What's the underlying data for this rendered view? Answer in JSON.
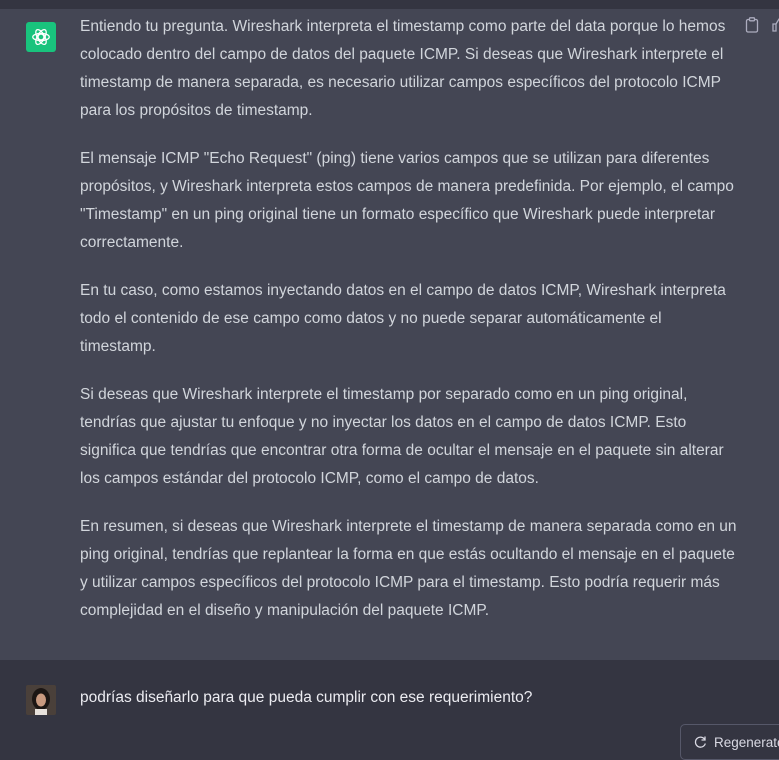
{
  "assistant_message": {
    "avatar_icon": "openai-logo-icon",
    "avatar_color": "#19c37d",
    "paragraphs": [
      "Entiendo tu pregunta. Wireshark interpreta el timestamp como parte del data porque lo hemos colocado dentro del campo de datos del paquete ICMP. Si deseas que Wireshark interprete el timestamp de manera separada, es necesario utilizar campos específicos del protocolo ICMP para los propósitos de timestamp.",
      "El mensaje ICMP \"Echo Request\" (ping) tiene varios campos que se utilizan para diferentes propósitos, y Wireshark interpreta estos campos de manera predefinida. Por ejemplo, el campo \"Timestamp\" en un ping original tiene un formato específico que Wireshark puede interpretar correctamente.",
      "En tu caso, como estamos inyectando datos en el campo de datos ICMP, Wireshark interpreta todo el contenido de ese campo como datos y no puede separar automáticamente el timestamp.",
      "Si deseas que Wireshark interprete el timestamp por separado como en un ping original, tendrías que ajustar tu enfoque y no inyectar los datos en el campo de datos ICMP. Esto significa que tendrías que encontrar otra forma de ocultar el mensaje en el paquete sin alterar los campos estándar del protocolo ICMP, como el campo de datos.",
      "En resumen, si deseas que Wireshark interprete el timestamp de manera separada como en un ping original, tendrías que replantear la forma en que estás ocultando el mensaje en el paquete y utilizar campos específicos del protocolo ICMP para el timestamp. Esto podría requerir más complejidad en el diseño y manipulación del paquete ICMP."
    ]
  },
  "user_message": {
    "avatar_icon": "user-photo-avatar",
    "text": "podrías diseñarlo para que pueda cumplir con ese requerimiento?"
  },
  "actions": {
    "copy_icon": "clipboard-icon",
    "feedback_icon": "thumbs-up-icon",
    "regenerate_label": "Regenerate",
    "regenerate_icon": "refresh-icon"
  },
  "colors": {
    "page_bg": "#343541",
    "assistant_bg": "#444654",
    "text": "#d1d5db",
    "accent": "#19c37d"
  }
}
